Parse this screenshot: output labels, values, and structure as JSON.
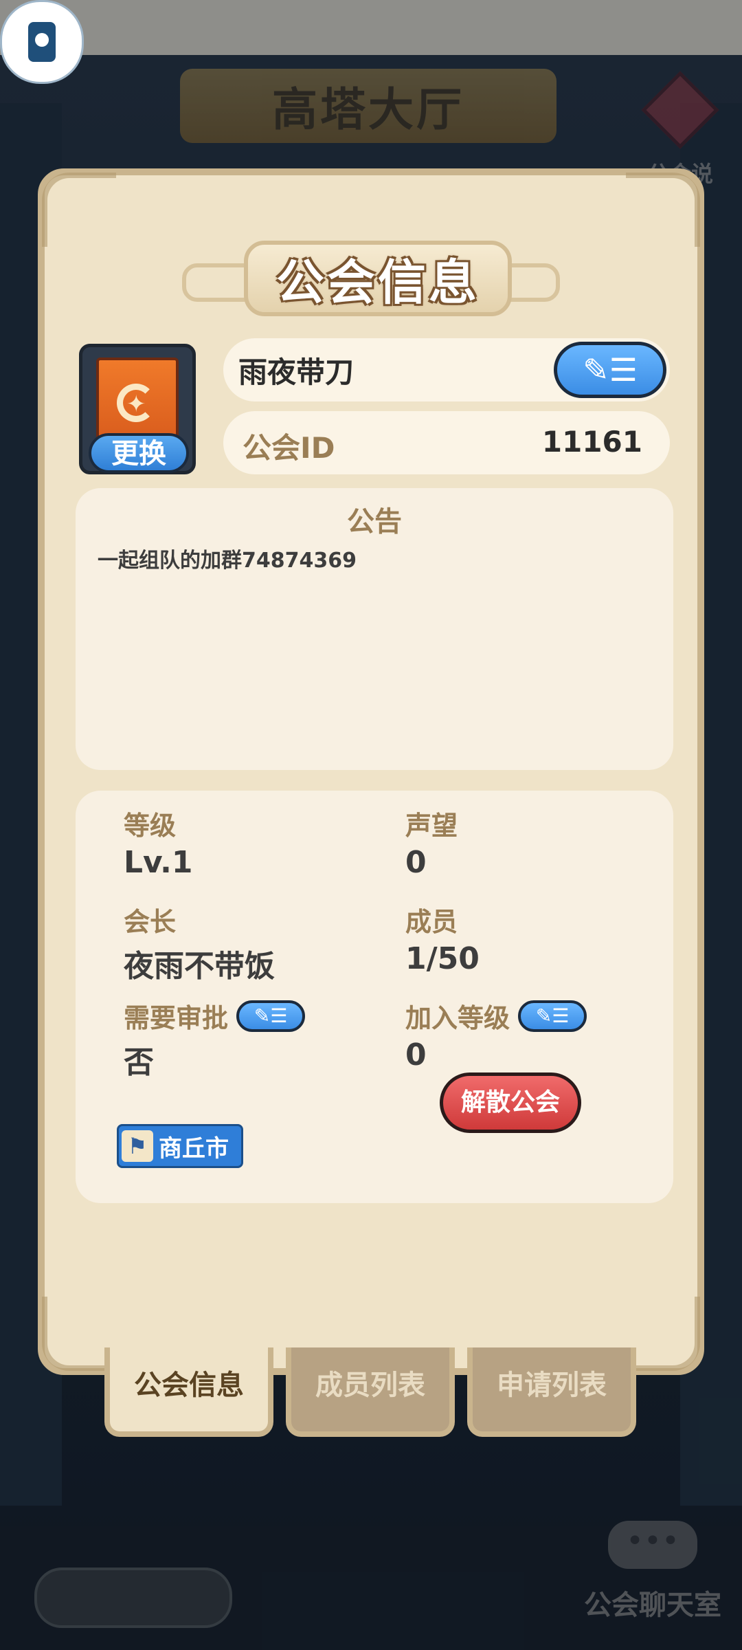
{
  "background": {
    "hall_title": "高塔大厅",
    "help_label": "公会说明",
    "chat_label": "公会聊天室",
    "chat_bubble": "•••"
  },
  "panel": {
    "title": "公会信息",
    "guild_name": "雨夜带刀",
    "change_label": "更换",
    "id_label": "公会ID",
    "id_value": "11161",
    "notice_title": "公告",
    "notice_text": "一起组队的加群74874369",
    "stats": {
      "level_label": "等级",
      "level_value": "Lv.1",
      "prestige_label": "声望",
      "prestige_value": "0",
      "leader_label": "会长",
      "leader_value": "夜雨不带饭",
      "members_label": "成员",
      "members_value": "1/50",
      "approval_label": "需要审批",
      "approval_value": "否",
      "join_level_label": "加入等级",
      "join_level_value": "0"
    },
    "location": "商丘市",
    "disband_label": "解散公会"
  },
  "tabs": [
    {
      "label": "公会信息",
      "active": true
    },
    {
      "label": "成员列表",
      "active": false
    },
    {
      "label": "申请列表",
      "active": false
    }
  ],
  "icons": {
    "edit": "edit-icon",
    "emblem": "moon-banner-emblem",
    "location": "flag-icon",
    "help": "info-icon",
    "floating": "device-icon"
  },
  "colors": {
    "panel_bg": "#efe3c8",
    "accent_blue": "#3b8de5",
    "danger_red": "#cf3a3a",
    "label_brown": "#9a7e55"
  }
}
